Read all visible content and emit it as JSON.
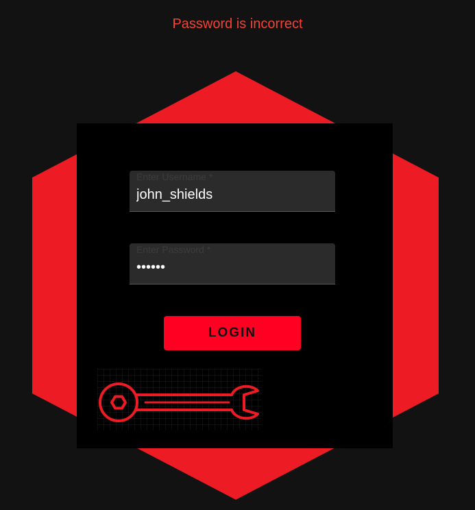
{
  "error": {
    "message": "Password is incorrect"
  },
  "form": {
    "username_label": "Enter Username *",
    "username_value": "john_shields",
    "password_label": "Enter Password *",
    "password_value": "123456",
    "login_label": "LOGIN"
  },
  "theme": {
    "background": "#121212",
    "hexagon": "#ed1c24",
    "panel": "#000000",
    "field": "#2b2b2b",
    "button": "#ff0022",
    "error_text": "#f44336"
  },
  "icons": {
    "hero": "wrench-icon"
  }
}
